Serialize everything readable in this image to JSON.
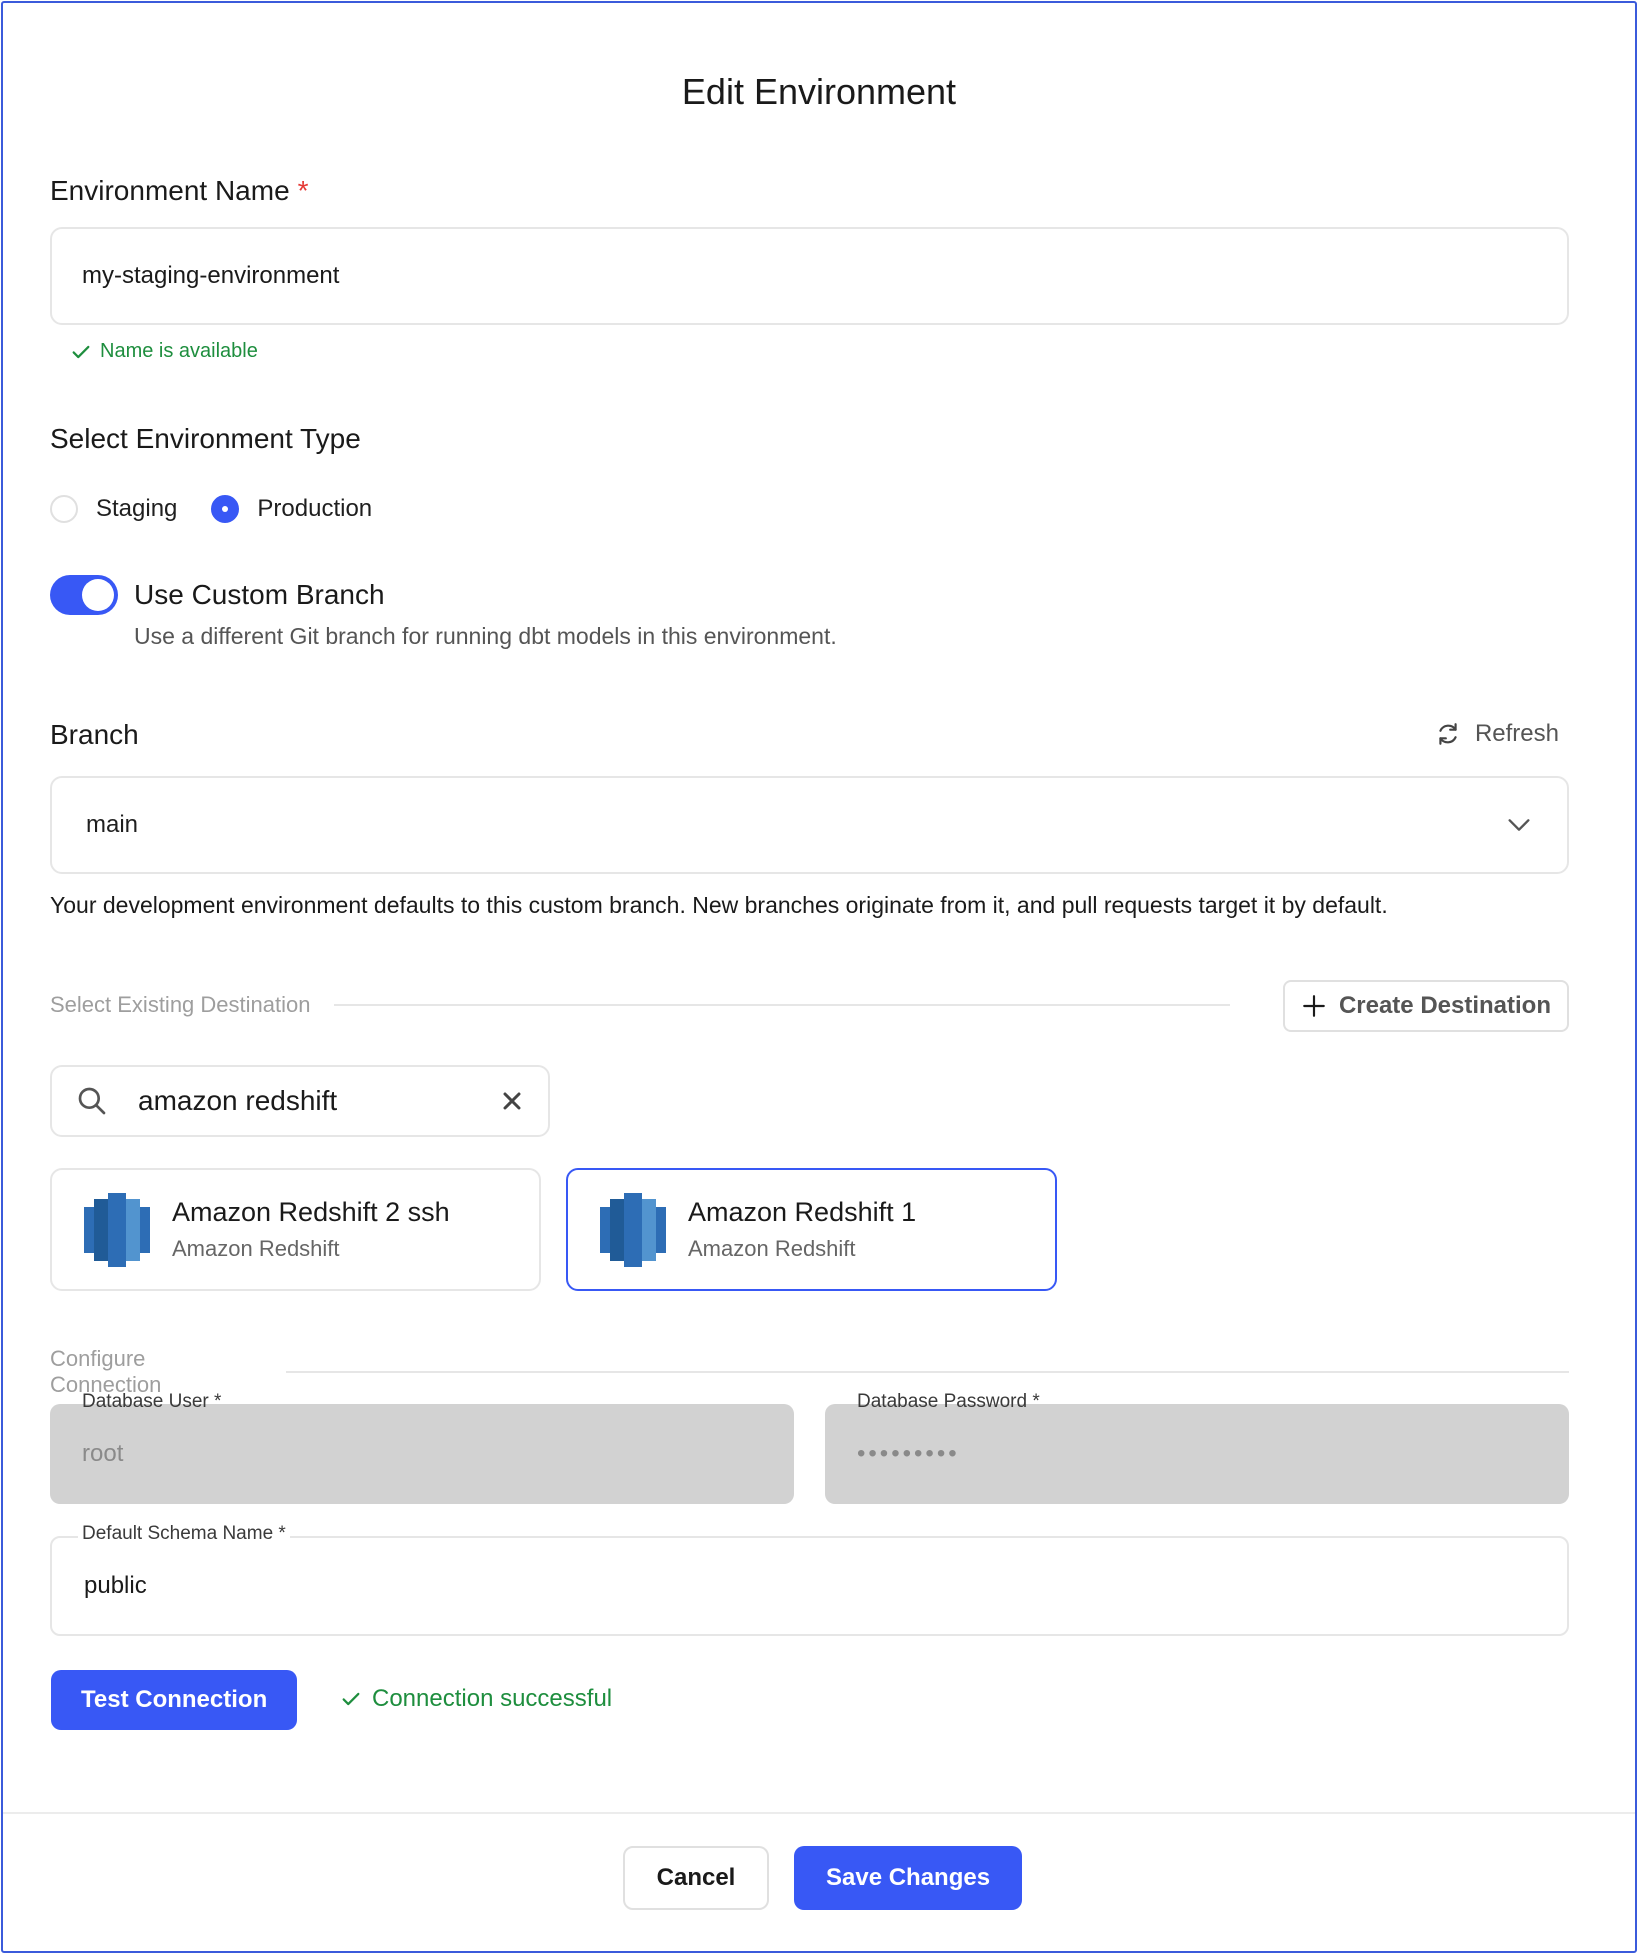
{
  "dialog": {
    "title": "Edit Environment"
  },
  "env_name": {
    "label": "Environment Name",
    "required_mark": "*",
    "value": "my-staging-environment",
    "status": "Name is available"
  },
  "env_type": {
    "label": "Select Environment Type",
    "options": [
      {
        "label": "Staging",
        "selected": false
      },
      {
        "label": "Production",
        "selected": true
      }
    ]
  },
  "custom_branch": {
    "enabled": true,
    "title": "Use Custom Branch",
    "description": "Use a different Git branch for running dbt models in this environment."
  },
  "branch": {
    "label": "Branch",
    "refresh_label": "Refresh",
    "selected": "main",
    "note": "Your development environment defaults to this custom branch. New branches originate from it, and pull requests target it by default."
  },
  "destination": {
    "section_label": "Select Existing Destination",
    "create_label": "Create Destination",
    "search_value": "amazon redshift",
    "cards": [
      {
        "name": "Amazon Redshift 2 ssh",
        "type": "Amazon Redshift",
        "selected": false
      },
      {
        "name": "Amazon Redshift 1",
        "type": "Amazon Redshift",
        "selected": true
      }
    ]
  },
  "connection": {
    "section_label": "Configure Connection",
    "db_user_label": "Database User *",
    "db_user_value": "root",
    "db_password_label": "Database Password *",
    "db_password_value": "•••••••••",
    "schema_label": "Default Schema Name *",
    "schema_value": "public",
    "test_label": "Test Connection",
    "test_status": "Connection successful"
  },
  "footer": {
    "cancel_label": "Cancel",
    "save_label": "Save Changes"
  },
  "colors": {
    "accent": "#3858f5",
    "success": "#1e8e3e",
    "required": "#e53935"
  }
}
